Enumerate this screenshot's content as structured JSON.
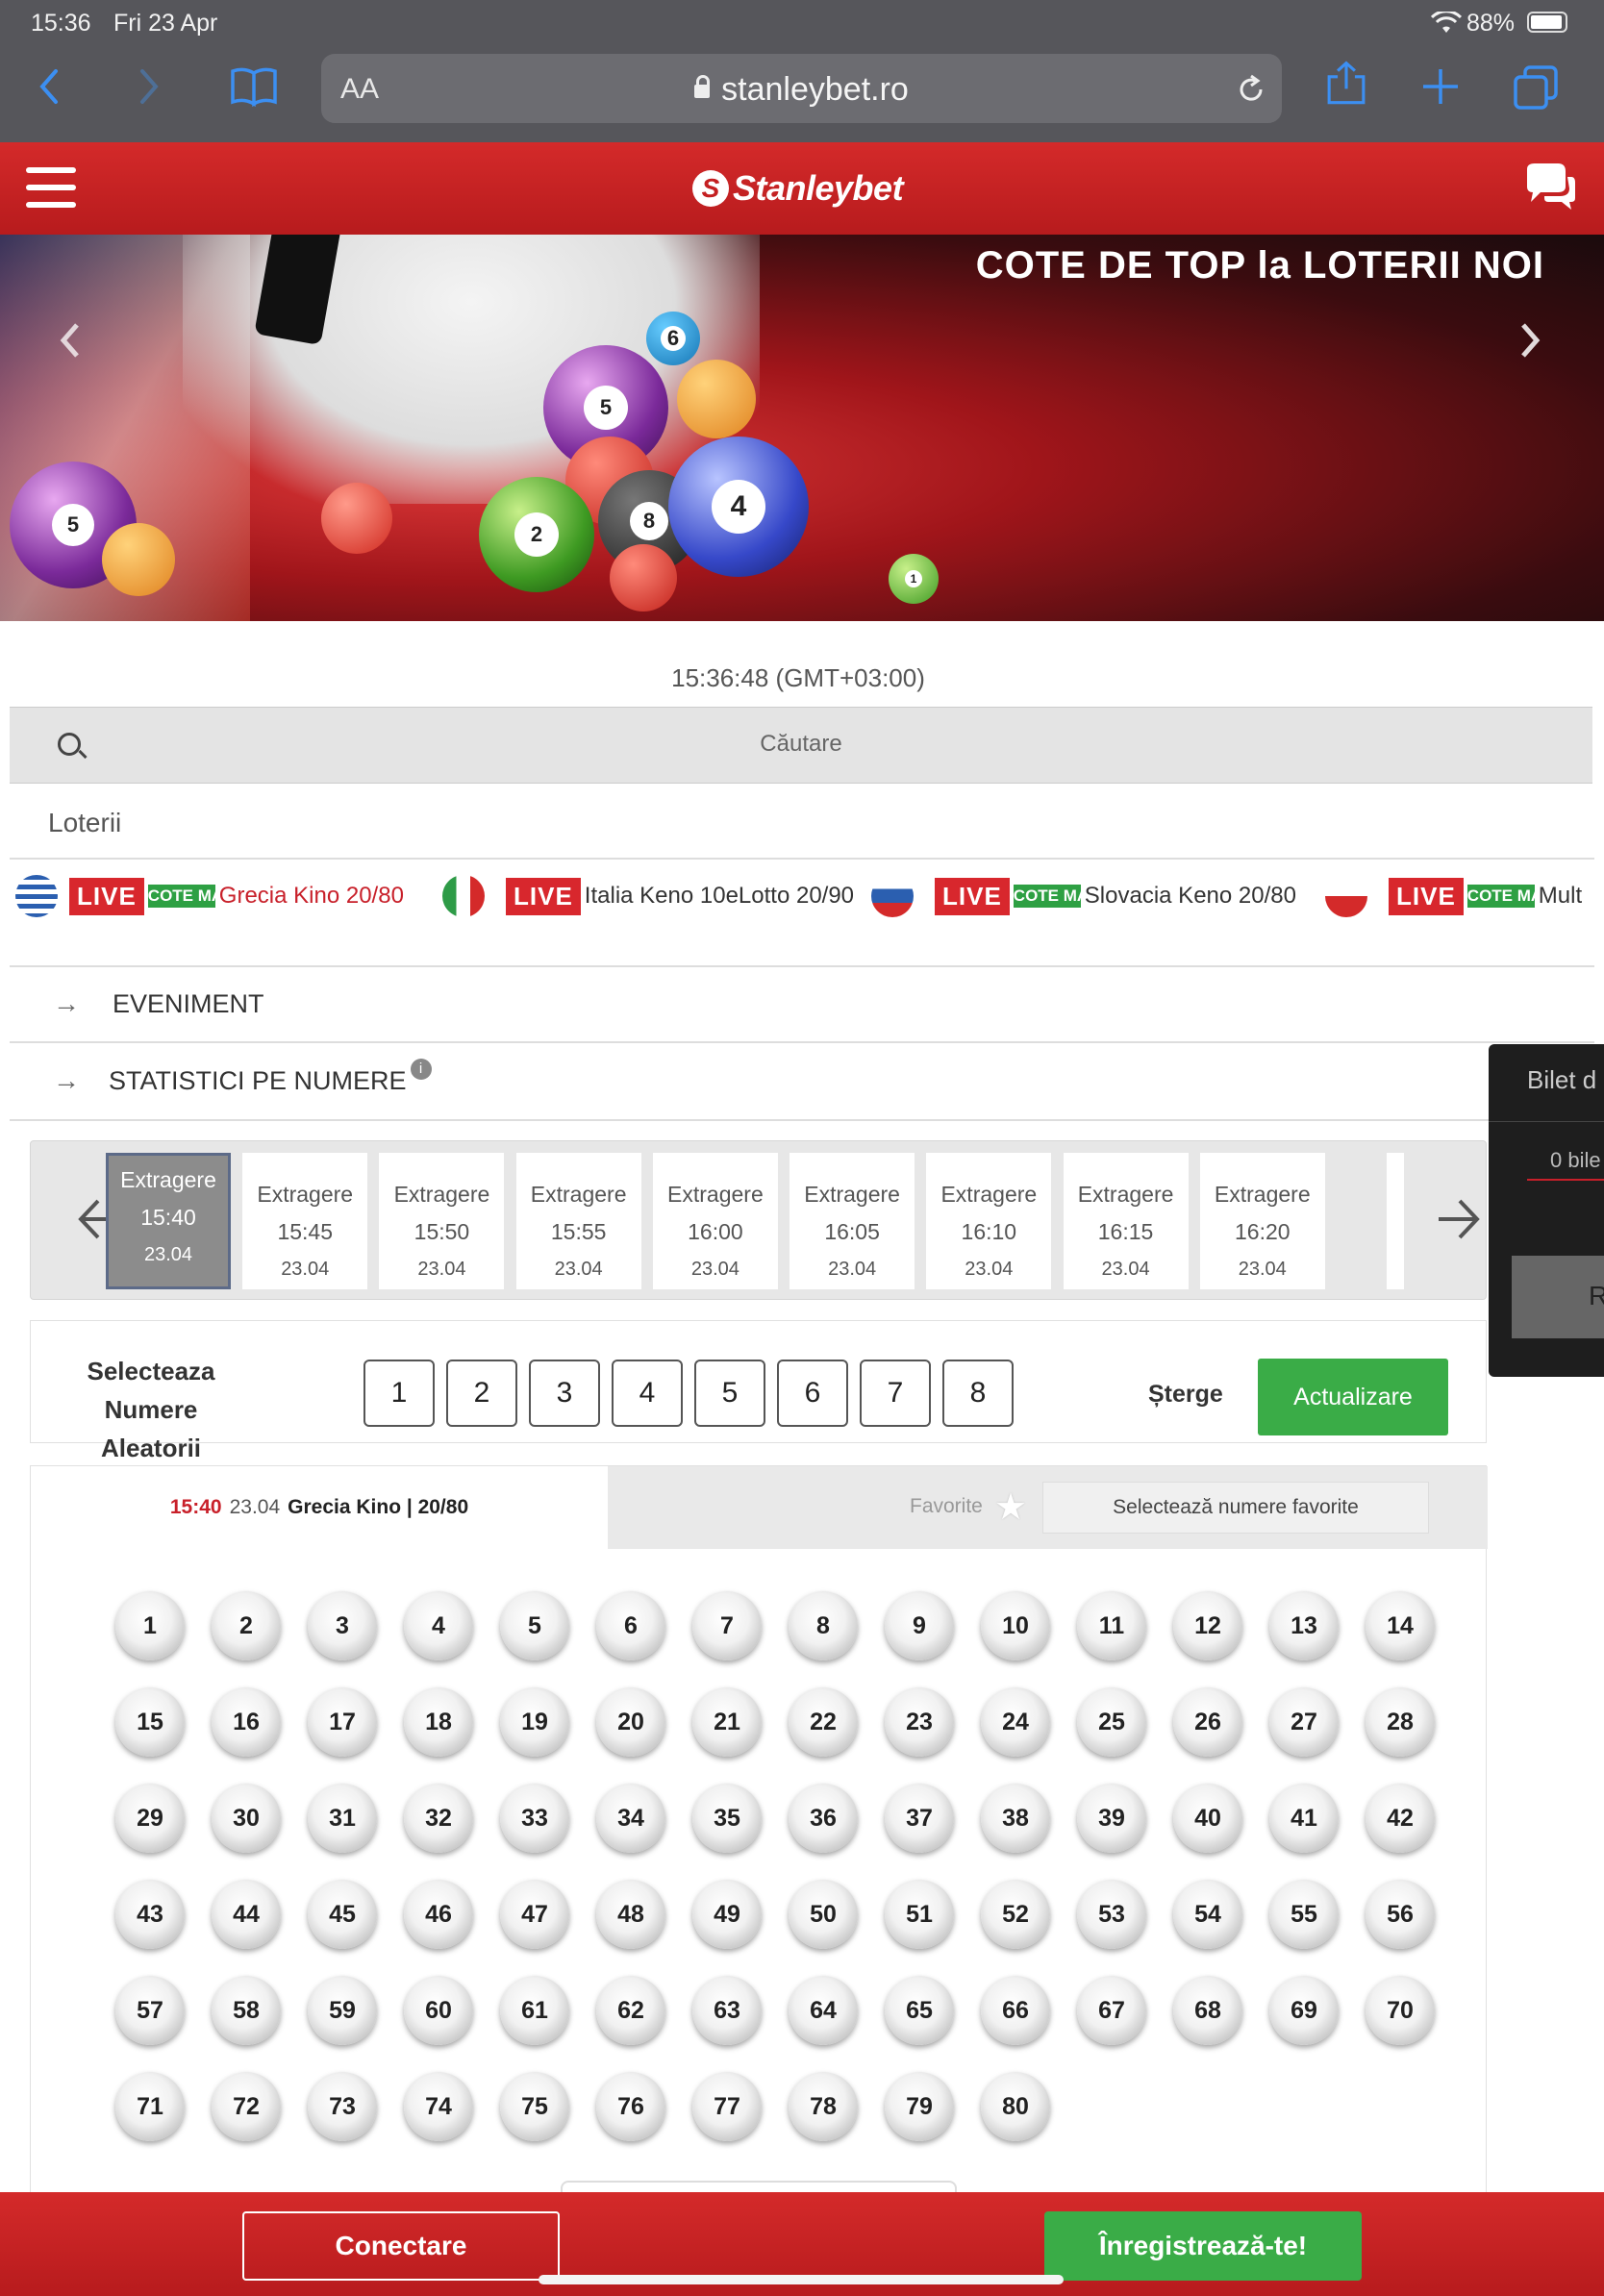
{
  "device": {
    "time": "15:36",
    "date": "Fri 23 Apr",
    "battery": "88%"
  },
  "browser": {
    "text_size_label": "AA",
    "url": "stanleybet.ro"
  },
  "site": {
    "brand": "Stanleybet",
    "accent_color": "#c41f21",
    "banner_headline": "COTE DE TOP la LOTERII NOI",
    "banner_balls": [
      "6",
      "5",
      "8",
      "4",
      "2",
      "8",
      "5",
      "1"
    ]
  },
  "main": {
    "clock": "15:36:48 (GMT+03:00)",
    "search_placeholder": "Căutare",
    "section_label": "Loterii",
    "lotteries": [
      {
        "live": "LIVE",
        "cote": "COTE MARITE",
        "name": "Grecia Kino 20/80",
        "has_cote": true
      },
      {
        "live": "LIVE",
        "cote": "",
        "name": "Italia Keno 10eLotto 20/90",
        "has_cote": false
      },
      {
        "live": "LIVE",
        "cote": "COTE MARITE",
        "name": "Slovacia Keno 20/80",
        "has_cote": true
      },
      {
        "live": "LIVE",
        "cote": "COTE MARITE",
        "name": "Mult",
        "has_cote": true
      }
    ],
    "accordion": [
      {
        "label": "EVENIMENT"
      },
      {
        "label": "STATISTICI PE NUMERE",
        "info": "i"
      }
    ]
  },
  "draws": {
    "items": [
      {
        "label": "Extragere",
        "time": "15:40",
        "date": "23.04"
      },
      {
        "label": "Extragere",
        "time": "15:45",
        "date": "23.04"
      },
      {
        "label": "Extragere",
        "time": "15:50",
        "date": "23.04"
      },
      {
        "label": "Extragere",
        "time": "15:55",
        "date": "23.04"
      },
      {
        "label": "Extragere",
        "time": "16:00",
        "date": "23.04"
      },
      {
        "label": "Extragere",
        "time": "16:05",
        "date": "23.04"
      },
      {
        "label": "Extragere",
        "time": "16:10",
        "date": "23.04"
      },
      {
        "label": "Extragere",
        "time": "16:15",
        "date": "23.04"
      },
      {
        "label": "Extragere",
        "time": "16:20",
        "date": "23.04"
      }
    ]
  },
  "random_select": {
    "title": "Selecteaza Numere Aleatorii",
    "options": [
      "1",
      "2",
      "3",
      "4",
      "5",
      "6",
      "7",
      "8"
    ],
    "clear_label": "Șterge",
    "update_label": "Actualizare"
  },
  "board": {
    "tab": {
      "time": "15:40",
      "date": "23.04",
      "game": "Grecia Kino | 20/80"
    },
    "favorites_label": "Favorite",
    "select_favorites_label": "Selectează numere favorite",
    "numbers": [
      "1",
      "2",
      "3",
      "4",
      "5",
      "6",
      "7",
      "8",
      "9",
      "10",
      "11",
      "12",
      "13",
      "14",
      "15",
      "16",
      "17",
      "18",
      "19",
      "20",
      "21",
      "22",
      "23",
      "24",
      "25",
      "26",
      "27",
      "28",
      "29",
      "30",
      "31",
      "32",
      "33",
      "34",
      "35",
      "36",
      "37",
      "38",
      "39",
      "40",
      "41",
      "42",
      "43",
      "44",
      "45",
      "46",
      "47",
      "48",
      "49",
      "50",
      "51",
      "52",
      "53",
      "54",
      "55",
      "56",
      "57",
      "58",
      "59",
      "60",
      "61",
      "62",
      "63",
      "64",
      "65",
      "66",
      "67",
      "68",
      "69",
      "70",
      "71",
      "72",
      "73",
      "74",
      "75",
      "76",
      "77",
      "78",
      "79",
      "80"
    ]
  },
  "betslip": {
    "title": "Bilet d",
    "count": "0 bile",
    "button": "R"
  },
  "footer": {
    "login_label": "Conectare",
    "register_label": "Înregistrează-te!"
  }
}
